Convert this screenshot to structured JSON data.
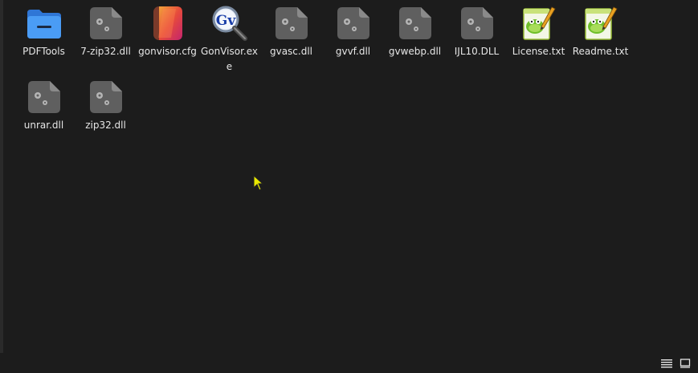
{
  "window": {
    "files": [
      {
        "name": "PDFTools",
        "icon": "folder-icon"
      },
      {
        "name": "7-zip32.dll",
        "icon": "dll-file-icon"
      },
      {
        "name": "gonvisor.cfg",
        "icon": "cfg-file-icon"
      },
      {
        "name": "GonVisor.exe",
        "icon": "gonvisor-app-icon"
      },
      {
        "name": "gvasc.dll",
        "icon": "dll-file-icon"
      },
      {
        "name": "gvvf.dll",
        "icon": "dll-file-icon"
      },
      {
        "name": "gvwebp.dll",
        "icon": "dll-file-icon"
      },
      {
        "name": "IJL10.DLL",
        "icon": "dll-file-icon"
      },
      {
        "name": "License.txt",
        "icon": "notepadpp-text-icon"
      },
      {
        "name": "Readme.txt",
        "icon": "notepadpp-text-icon"
      },
      {
        "name": "unrar.dll",
        "icon": "dll-file-icon"
      },
      {
        "name": "zip32.dll",
        "icon": "dll-file-icon"
      }
    ]
  },
  "statusbar": {
    "view_modes": [
      "list-view-icon",
      "icon-view-icon"
    ]
  },
  "colors": {
    "background": "#1c1c1c",
    "text": "#e6e6e6",
    "folder": "#3d8ff0",
    "dll_icon": "#5f5f5f",
    "cursor": "#e8e800"
  }
}
